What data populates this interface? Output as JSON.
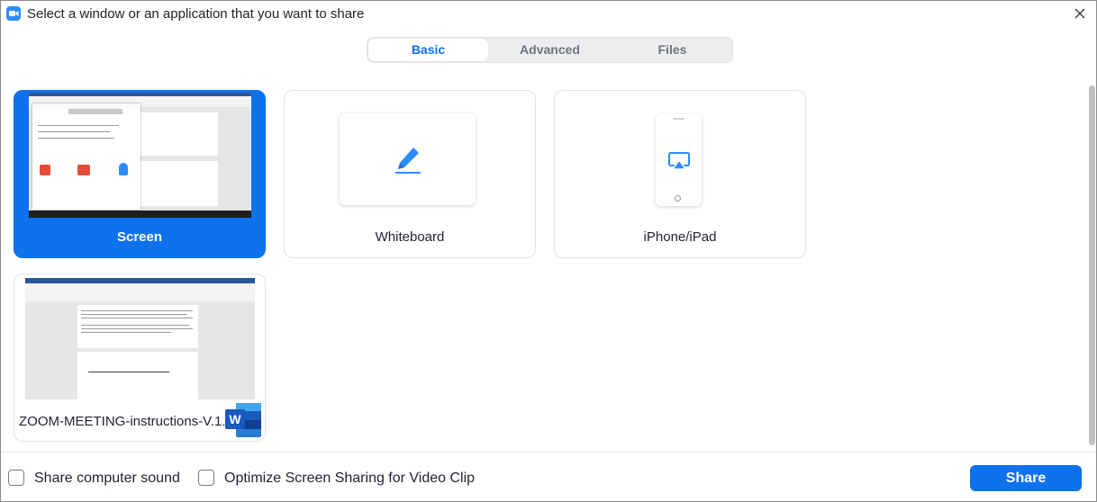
{
  "window": {
    "title": "Select a window or an application that you want to share",
    "app_icon": "zoom-camera-icon",
    "close_icon": "close-icon"
  },
  "tabs": [
    {
      "label": "Basic",
      "active": true
    },
    {
      "label": "Advanced",
      "active": false
    },
    {
      "label": "Files",
      "active": false
    }
  ],
  "tiles": {
    "screen": {
      "label": "Screen",
      "selected": true
    },
    "whiteboard": {
      "label": "Whiteboard",
      "icon": "pencil-icon"
    },
    "iphone": {
      "label": "iPhone/iPad",
      "icon": "airplay-icon"
    },
    "window1": {
      "label": "ZOOM-MEETING-instructions-V.1...",
      "icon": "word-icon"
    }
  },
  "footer": {
    "share_sound_label": "Share computer sound",
    "optimize_label": "Optimize Screen Sharing for Video Clip",
    "share_button": "Share"
  },
  "colors": {
    "accent": "#0e72ed",
    "tab_bg": "#ededf0",
    "word_blue": "#185abd"
  }
}
